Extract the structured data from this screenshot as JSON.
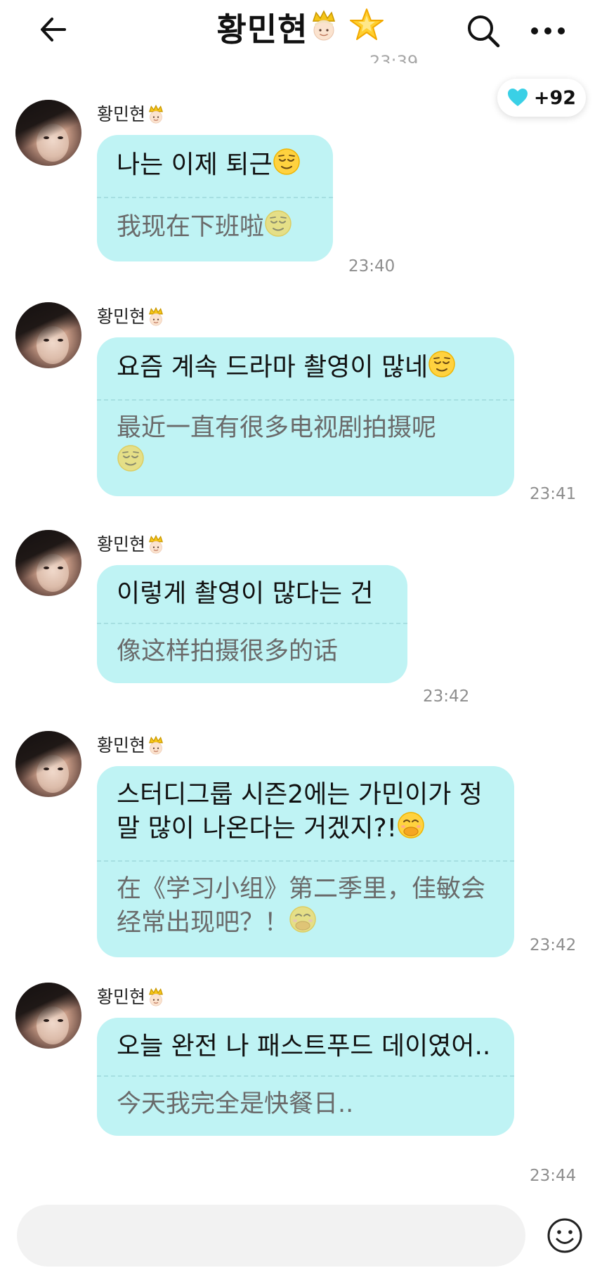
{
  "header": {
    "title": "황민현",
    "back_icon": "arrow-left-icon",
    "search_icon": "search-icon",
    "more_icon": "more-horizontal-icon"
  },
  "top_partial_time": "23:39",
  "heart_badge": {
    "icon": "heart-icon",
    "count": "+92",
    "color": "#3ad0e6"
  },
  "colors": {
    "bubble": "#bff3f4",
    "divider": "#a6dfe1",
    "translation_text": "#6a6a6a",
    "time_text": "#8e8e8e"
  },
  "messages": [
    {
      "sender": "황민현",
      "korean": "나는 이제 퇴근",
      "korean_emoji": "relieved-face-icon",
      "chinese": "我现在下班啦",
      "chinese_emoji": "relieved-face-icon",
      "time": "23:40"
    },
    {
      "sender": "황민현",
      "korean": "요즘 계속 드라마 촬영이 많네",
      "korean_emoji": "relieved-face-icon",
      "chinese": "最近一直有很多电视剧拍摄呢",
      "chinese_emoji": "relieved-face-icon",
      "time": "23:41"
    },
    {
      "sender": "황민현",
      "korean": "이렇게 촬영이 많다는 건",
      "korean_emoji": "",
      "chinese": "像这样拍摄很多的话",
      "chinese_emoji": "",
      "time": "23:42"
    },
    {
      "sender": "황민현",
      "korean": "스터디그룹 시즌2에는 가민이가 정말 많이 나온다는 거겠지?!",
      "korean_emoji": "hand-over-mouth-face-icon",
      "chinese": "在《学习小组》第二季里，佳敏会经常出现吧？！",
      "chinese_emoji": "hand-over-mouth-face-icon",
      "time": "23:42"
    },
    {
      "sender": "황민현",
      "korean": "오늘 완전 나 패스트푸드 데이였어..",
      "korean_emoji": "",
      "chinese": "今天我完全是快餐日..",
      "chinese_emoji": "",
      "time": "23:44"
    }
  ],
  "input": {
    "placeholder": "",
    "value": ""
  },
  "emoji_button_icon": "smiley-outline-icon"
}
